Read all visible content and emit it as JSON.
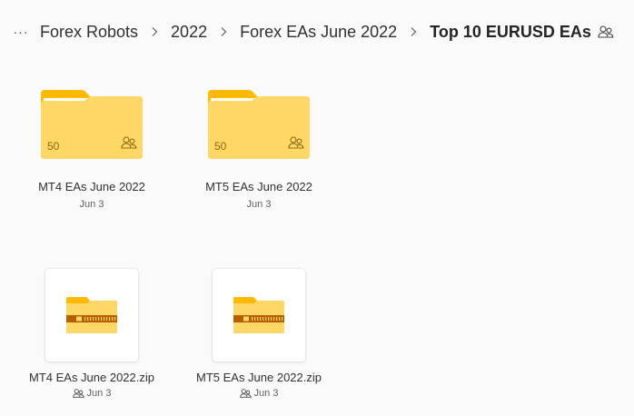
{
  "breadcrumb": {
    "more": "···",
    "items": [
      {
        "label": "Forex Robots"
      },
      {
        "label": "2022"
      },
      {
        "label": "Forex EAs June 2022"
      },
      {
        "label": "Top 10 EURUSD EAs"
      }
    ]
  },
  "folders": [
    {
      "name": "MT4 EAs June 2022",
      "date": "Jun 3",
      "count": "50"
    },
    {
      "name": "MT5 EAs June 2022",
      "date": "Jun 3",
      "count": "50"
    }
  ],
  "zips": [
    {
      "name": "MT4 EAs June 2022.zip",
      "date": "Jun 3"
    },
    {
      "name": "MT5 EAs June 2022.zip",
      "date": "Jun 3"
    }
  ],
  "icons": {
    "folder": "folder-icon",
    "zip": "zip-folder-icon",
    "shared": "shared-people-icon",
    "chevron": "chevron-right-icon"
  },
  "colors": {
    "folder_front": "#ffd766",
    "folder_back": "#ffb900",
    "zip_band": "#b85e00"
  }
}
